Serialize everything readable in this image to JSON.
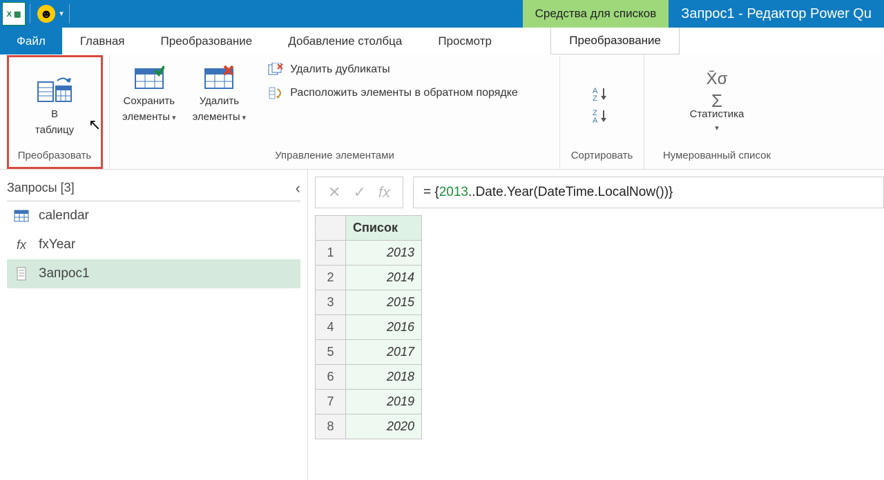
{
  "titlebar": {
    "context_title": "Средства для списков",
    "app_title": "Запрос1 - Редактор Power Qu"
  },
  "tabs": {
    "file": "Файл",
    "home": "Главная",
    "transform": "Преобразование",
    "addcol": "Добавление столбца",
    "view": "Просмотр",
    "context_transform": "Преобразование"
  },
  "ribbon": {
    "group_convert": "Преобразовать",
    "to_table_1": "В",
    "to_table_2": "таблицу",
    "keep_items_1": "Сохранить",
    "keep_items_2": "элементы",
    "remove_items_1": "Удалить",
    "remove_items_2": "элементы",
    "remove_dups": "Удалить дубликаты",
    "reverse_items": "Расположить элементы в обратном порядке",
    "group_manage": "Управление элементами",
    "group_sort": "Сортировать",
    "statistics": "Статистика",
    "group_numlist": "Нумерованный список"
  },
  "queries": {
    "header": "Запросы [3]",
    "items": [
      {
        "label": "calendar",
        "kind": "table"
      },
      {
        "label": "fxYear",
        "kind": "fx"
      },
      {
        "label": "Запрос1",
        "kind": "list"
      }
    ],
    "selected_index": 2
  },
  "formula_prefix": "= {",
  "formula_num": "2013",
  "formula_suffix": "..Date.Year(DateTime.LocalNow())}",
  "list": {
    "header": "Список",
    "rows": [
      "2013",
      "2014",
      "2015",
      "2016",
      "2017",
      "2018",
      "2019",
      "2020"
    ]
  }
}
